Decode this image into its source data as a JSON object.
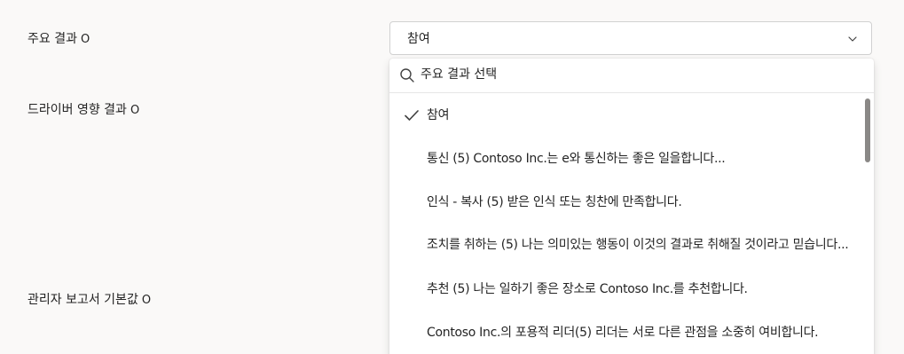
{
  "labels": {
    "key_results": "주요 결과",
    "driver_impact": "드라이버 영향 결과",
    "manager_report": "관리자 보고서 기본값",
    "info_glyph": "O"
  },
  "select": {
    "value": "참여"
  },
  "dropdown": {
    "search_placeholder": "주요 결과 선택",
    "options": [
      {
        "label": "참여",
        "selected": true
      },
      {
        "label": "통신 (5) Contoso Inc.는 e와 통신하는 좋은 일을합니다...",
        "selected": false
      },
      {
        "label": "인식 - 복사 (5) 받은 인식 또는 칭찬에 만족합니다.",
        "selected": false
      },
      {
        "label": "조치를 취하는 (5) 나는 의미있는 행동이 이것의 결과로 취해질 것이라고 믿습니다...",
        "selected": false
      },
      {
        "label": "추천 (5) 나는 일하기 좋은 장소로 Contoso Inc.를 추천합니다.",
        "selected": false
      },
      {
        "label": "Contoso Inc.의 포용적 리더(5) 리더는 서로 다른 관점을 소중히 여비합니다.",
        "selected": false
      }
    ]
  },
  "icons": {
    "search": "search-icon",
    "chevron": "chevron-down-icon",
    "check": "checkmark-icon"
  },
  "colors": {
    "background": "#faf9f8",
    "surface": "#ffffff",
    "text": "#242424",
    "border": "#d1d1d1",
    "scrollbar": "#8a8886"
  }
}
